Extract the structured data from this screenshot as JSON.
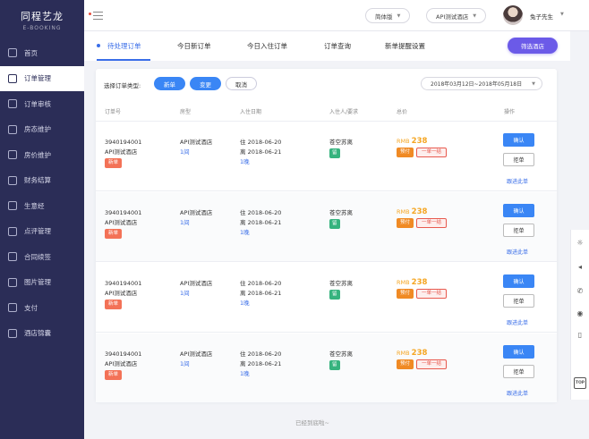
{
  "logo": {
    "cn": "同程艺龙",
    "en": "E-BOOKING"
  },
  "sidebar": {
    "items": [
      {
        "label": "首页",
        "icon": "grid-icon"
      },
      {
        "label": "订单管理",
        "icon": "order-icon",
        "active": true
      },
      {
        "label": "订单审核",
        "icon": "audit-icon"
      },
      {
        "label": "房态维护",
        "icon": "room-status-icon"
      },
      {
        "label": "房价维护",
        "icon": "room-price-icon"
      },
      {
        "label": "财务结算",
        "icon": "finance-icon"
      },
      {
        "label": "生意经",
        "icon": "user-icon"
      },
      {
        "label": "点评管理",
        "icon": "comment-icon"
      },
      {
        "label": "合同续签",
        "icon": "contract-icon"
      },
      {
        "label": "图片管理",
        "icon": "image-icon"
      },
      {
        "label": "支付",
        "icon": "pay-icon"
      },
      {
        "label": "酒店锦囊",
        "icon": "tips-icon"
      }
    ]
  },
  "topbar": {
    "version": "简体版",
    "hotel": "API测试酒店",
    "username": "兔子先生"
  },
  "tabs": [
    "待处理订单",
    "今日新订单",
    "今日入住订单",
    "订单查询",
    "新单提醒设置"
  ],
  "filter_button": "筛选酒店",
  "order_type": {
    "label": "选择订单类型:",
    "options": [
      "新单",
      "变更",
      "取消"
    ]
  },
  "date_range": "2018年03月12日~2018年05月18日",
  "columns": [
    "订单号",
    "房型",
    "入住日期",
    "入住人/要求",
    "总价",
    "操作"
  ],
  "orders": [
    {
      "order_no": "3940194001",
      "hotel": "API测试酒店",
      "type_tag": "新单",
      "room": "API测试酒店",
      "rooms": "1间",
      "checkin": "住 2018-06-20",
      "checkout": "离 2018-06-21",
      "nights": "1晚",
      "guest": "苍空苏离",
      "guest_tag": "留",
      "currency": "RMB",
      "price": "238",
      "pay_tag": "预付",
      "policy_tag": "一单一结",
      "confirm": "确认",
      "reject": "拒单",
      "follow": "跟进此单"
    },
    {
      "order_no": "3940194001",
      "hotel": "API测试酒店",
      "type_tag": "新单",
      "room": "API测试酒店",
      "rooms": "1间",
      "checkin": "住 2018-06-20",
      "checkout": "离 2018-06-21",
      "nights": "1晚",
      "guest": "苍空苏离",
      "guest_tag": "留",
      "currency": "RMB",
      "price": "238",
      "pay_tag": "预付",
      "policy_tag": "一单一结",
      "confirm": "确认",
      "reject": "拒单",
      "follow": "跟进此单"
    },
    {
      "order_no": "3940194001",
      "hotel": "API测试酒店",
      "type_tag": "新单",
      "room": "API测试酒店",
      "rooms": "1间",
      "checkin": "住 2018-06-20",
      "checkout": "离 2018-06-21",
      "nights": "1晚",
      "guest": "苍空苏离",
      "guest_tag": "留",
      "currency": "RMB",
      "price": "238",
      "pay_tag": "预付",
      "policy_tag": "一单一结",
      "confirm": "确认",
      "reject": "拒单",
      "follow": "跟进此单"
    },
    {
      "order_no": "3940194001",
      "hotel": "API测试酒店",
      "type_tag": "新单",
      "room": "API测试酒店",
      "rooms": "1间",
      "checkin": "住 2018-06-20",
      "checkout": "离 2018-06-21",
      "nights": "1晚",
      "guest": "苍空苏离",
      "guest_tag": "留",
      "currency": "RMB",
      "price": "238",
      "pay_tag": "预付",
      "policy_tag": "一单一结",
      "confirm": "确认",
      "reject": "拒单",
      "follow": "跟进此单"
    }
  ],
  "footer_note": "已经到底啦~",
  "right_toolbar": {
    "top_label": "TOP"
  },
  "colors": {
    "sidebar": "#2b2d57",
    "accent": "#3a86f5",
    "purple": "#6b5ae8",
    "price": "#f5a623",
    "new_tag": "#f37257",
    "green": "#36b37e"
  }
}
